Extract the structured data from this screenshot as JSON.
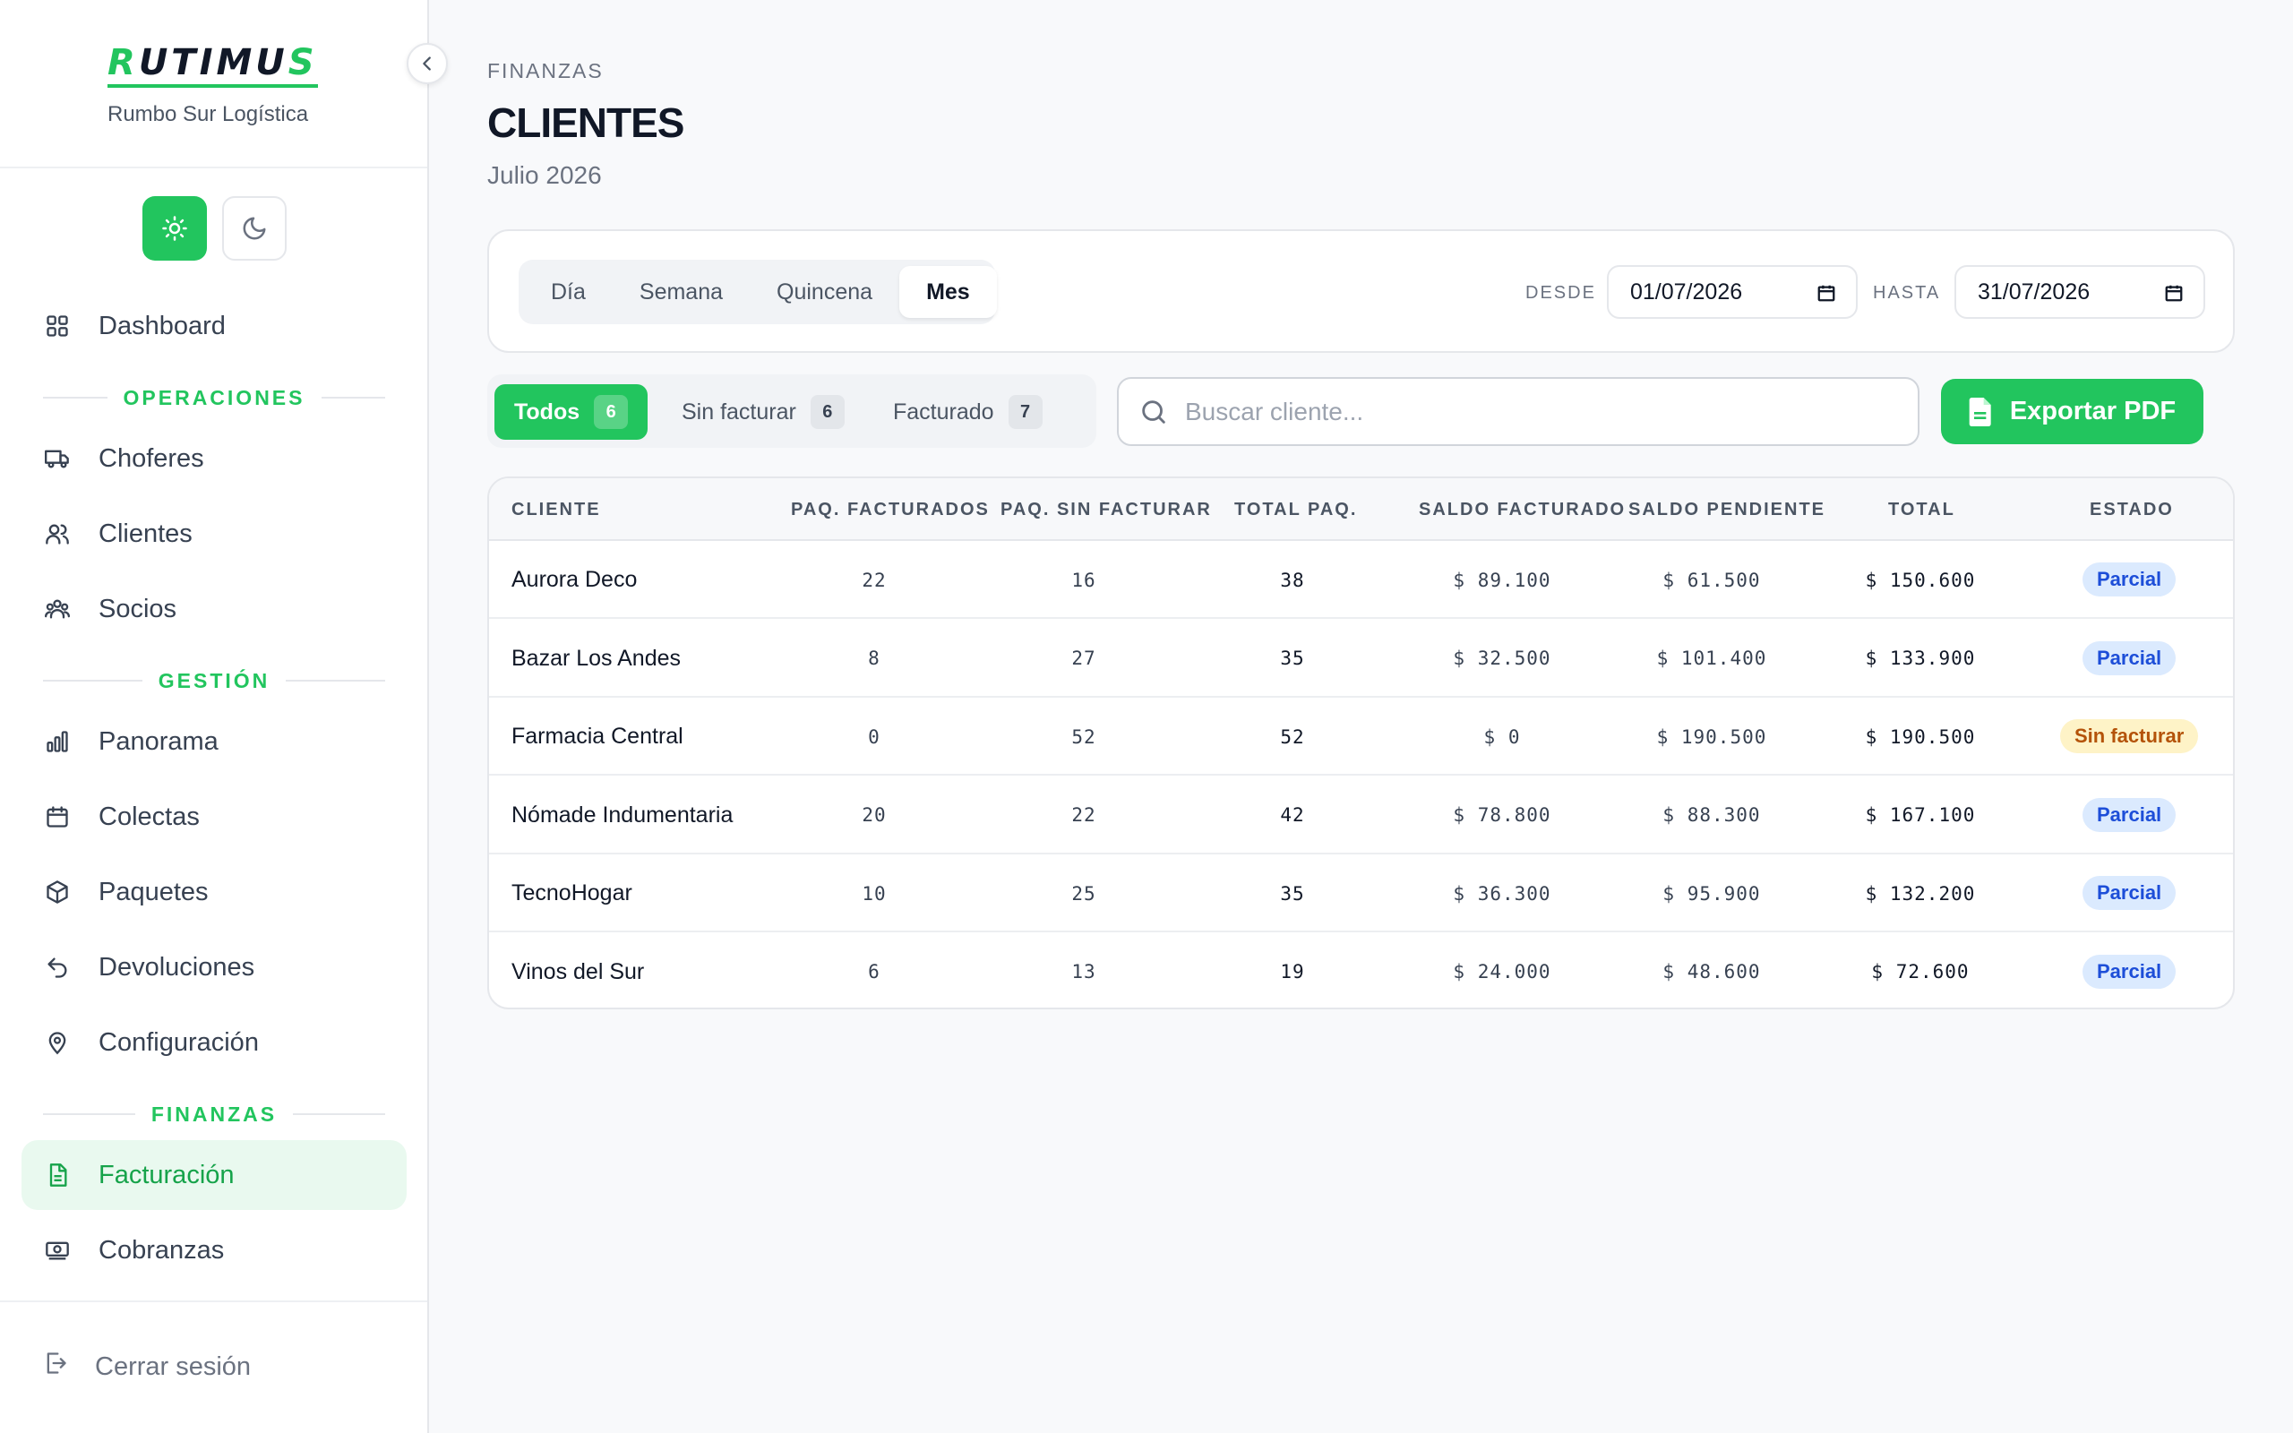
{
  "brand": {
    "logo_prefix": "R",
    "logo_middle": "UTIMU",
    "logo_suffix": "S",
    "company": "Rumbo Sur Logística"
  },
  "sidebar": {
    "dashboard": "Dashboard",
    "sections": {
      "operaciones": "OPERACIONES",
      "gestion": "GESTIÓN",
      "finanzas": "FINANZAS"
    },
    "items": {
      "choferes": "Choferes",
      "clientes": "Clientes",
      "socios": "Socios",
      "panorama": "Panorama",
      "colectas": "Colectas",
      "paquetes": "Paquetes",
      "devoluciones": "Devoluciones",
      "configuracion": "Configuración",
      "facturacion": "Facturación",
      "cobranzas": "Cobranzas"
    },
    "logout": "Cerrar sesión"
  },
  "header": {
    "breadcrumb": "FINANZAS",
    "title": "CLIENTES",
    "period": "Julio 2026"
  },
  "filters": {
    "periods": [
      "Día",
      "Semana",
      "Quincena",
      "Mes"
    ],
    "active_period": "Mes",
    "desde_label": "DESDE",
    "desde_value": "01/07/2026",
    "hasta_label": "HASTA",
    "hasta_value": "31/07/2026"
  },
  "status_tabs": [
    {
      "label": "Todos",
      "count": "6"
    },
    {
      "label": "Sin facturar",
      "count": "6"
    },
    {
      "label": "Facturado",
      "count": "7"
    }
  ],
  "search": {
    "placeholder": "Buscar cliente..."
  },
  "export": {
    "label": "Exportar PDF"
  },
  "table": {
    "headers": [
      "CLIENTE",
      "PAQ. FACTURADOS",
      "PAQ. SIN FACTURAR",
      "TOTAL PAQ.",
      "SALDO FACTURADO",
      "SALDO PENDIENTE",
      "TOTAL",
      "ESTADO"
    ],
    "rows": [
      {
        "cliente": "Aurora Deco",
        "facturados": "22",
        "sin_facturar": "16",
        "total_paq": "38",
        "saldo_facturado": "$ 89.100",
        "saldo_pendiente": "$ 61.500",
        "total": "$ 150.600",
        "estado": "Parcial"
      },
      {
        "cliente": "Bazar Los Andes",
        "facturados": "8",
        "sin_facturar": "27",
        "total_paq": "35",
        "saldo_facturado": "$ 32.500",
        "saldo_pendiente": "$ 101.400",
        "total": "$ 133.900",
        "estado": "Parcial"
      },
      {
        "cliente": "Farmacia Central",
        "facturados": "0",
        "sin_facturar": "52",
        "total_paq": "52",
        "saldo_facturado": "$ 0",
        "saldo_pendiente": "$ 190.500",
        "total": "$ 190.500",
        "estado": "Sin facturar"
      },
      {
        "cliente": "Nómade Indumentaria",
        "facturados": "20",
        "sin_facturar": "22",
        "total_paq": "42",
        "saldo_facturado": "$ 78.800",
        "saldo_pendiente": "$ 88.300",
        "total": "$ 167.100",
        "estado": "Parcial"
      },
      {
        "cliente": "TecnoHogar",
        "facturados": "10",
        "sin_facturar": "25",
        "total_paq": "35",
        "saldo_facturado": "$ 36.300",
        "saldo_pendiente": "$ 95.900",
        "total": "$ 132.200",
        "estado": "Parcial"
      },
      {
        "cliente": "Vinos del Sur",
        "facturados": "6",
        "sin_facturar": "13",
        "total_paq": "19",
        "saldo_facturado": "$ 24.000",
        "saldo_pendiente": "$ 48.600",
        "total": "$ 72.600",
        "estado": "Parcial"
      }
    ]
  },
  "colors": {
    "accent": "#22c55e",
    "parcial_bg": "#dbeafe",
    "parcial_fg": "#1d4ed8",
    "sin_facturar_bg": "#fef3c7",
    "sin_facturar_fg": "#b45309"
  }
}
